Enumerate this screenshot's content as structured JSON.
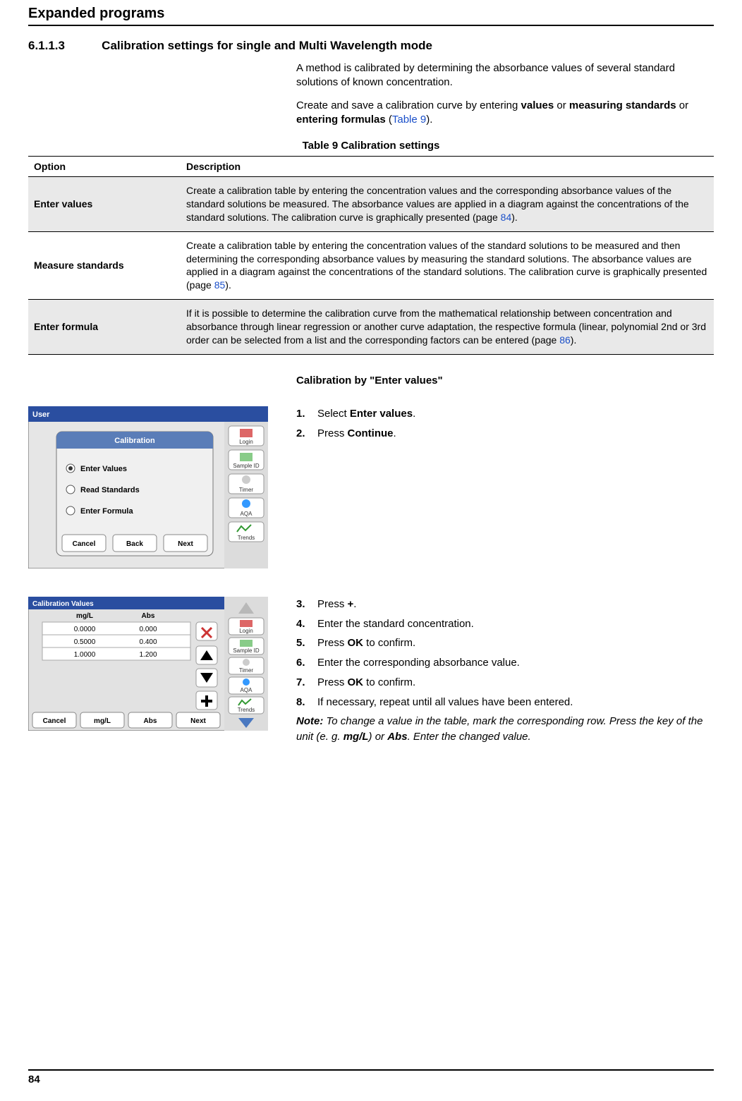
{
  "header": {
    "title": "Expanded programs"
  },
  "section": {
    "number": "6.1.1.3",
    "title": "Calibration settings for single and Multi Wavelength mode"
  },
  "intro": {
    "p1": "A method is calibrated by determining the absorbance values of several standard solutions of known concentration.",
    "p2_pre": "Create and save a calibration curve by entering ",
    "p2_b1": "values",
    "p2_mid1": " or ",
    "p2_b2": "measuring standards",
    "p2_mid2": "  or ",
    "p2_b3": "entering formulas",
    "p2_open": " (",
    "p2_link": "Table 9",
    "p2_close": ")."
  },
  "table": {
    "caption": "Table 9 Calibration settings",
    "h1": "Option",
    "h2": "Description",
    "rows": [
      {
        "opt": "Enter values",
        "desc_pre": "Create a calibration table by entering the concentration values and the corresponding absorbance values of the standard solutions be measured. The absorbance values are applied in a diagram against the concentrations of the standard solutions. The calibration curve is graphically presented (page ",
        "desc_link": "84",
        "desc_post": ")."
      },
      {
        "opt": "Measure standards",
        "desc_pre": "Create a calibration table by entering the concentration values of the standard solutions to be measured and then determining the corresponding absorbance values by measuring the standard solutions. The absorbance values are applied in a diagram against the concentrations of the standard solutions. The calibration curve is graphically presented (page  ",
        "desc_link": "85",
        "desc_post": ")."
      },
      {
        "opt": "Enter formula",
        "desc_pre": "If it is possible to determine the calibration curve from the mathematical relationship between concentration and absorbance through linear regression or another curve adaptation, the respective formula (linear, polynomial 2nd or 3rd order can be selected from a list and the corresponding factors can be entered (page ",
        "desc_link": "86",
        "desc_post": ")."
      }
    ]
  },
  "sub_heading": "Calibration by \"Enter values\"",
  "screenshot1": {
    "title": "Calibration",
    "opt1": "Enter Values",
    "opt2": "Read Standards",
    "opt3": "Enter Formula",
    "btn_cancel": "Cancel",
    "btn_back": "Back",
    "btn_next": "Next",
    "side_login": "Login",
    "side_sample": "Sample ID",
    "side_timer": "Timer",
    "side_aqa": "AQA",
    "side_trends": "Trends",
    "top": "User"
  },
  "steps1": {
    "s1_pre": "Select ",
    "s1_b": "Enter values",
    "s1_post": ".",
    "s2_pre": "Press ",
    "s2_b": "Continue",
    "s2_post": "."
  },
  "screenshot2": {
    "title": "Calibration Values",
    "col1": "mg/L",
    "col2": "Abs",
    "r1c1": "0.0000",
    "r1c2": "0.000",
    "r2c1": "0.5000",
    "r2c2": "0.400",
    "r3c1": "1.0000",
    "r3c2": "1.200",
    "btn_cancel": "Cancel",
    "btn_unit": "mg/L",
    "btn_abs": "Abs",
    "btn_next": "Next",
    "side_login": "Login",
    "side_sample": "Sample ID",
    "side_timer": "Timer",
    "side_aqa": "AQA",
    "side_trends": "Trends"
  },
  "steps2": {
    "s3_pre": "Press ",
    "s3_b": "+",
    "s3_post": ".",
    "s4": "Enter the standard concentration.",
    "s5_pre": "Press ",
    "s5_b": "OK",
    "s5_post": " to confirm.",
    "s6": "Enter the corresponding absorbance value.",
    "s7_pre": "Press ",
    "s7_b": "OK",
    "s7_post": " to confirm.",
    "s8": "If necessary, repeat until all values have been entered.",
    "note_b": "Note:",
    "note_t1": " To change a value in the table, mark the corresponding row. Press the key of the unit (e. g. ",
    "note_b2": "mg/L",
    "note_t2": ") or ",
    "note_b3": "Abs",
    "note_t3": ". Enter the changed value."
  },
  "footer": {
    "page": "84"
  }
}
